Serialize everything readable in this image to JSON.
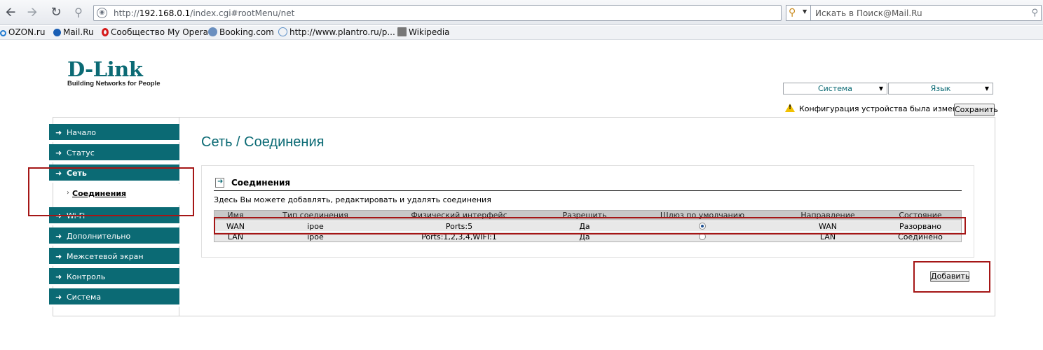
{
  "browser": {
    "url_prefix": "http://",
    "url_host": "192.168.0.1",
    "url_path": "/index.cgi#rootMenu/net",
    "search_placeholder": "Искать в Поиск@Mail.Ru"
  },
  "bookmarks": [
    {
      "label": "OZON.ru",
      "color": "#1f7ad1"
    },
    {
      "label": "Mail.Ru",
      "color": "#1a5fb4"
    },
    {
      "label": "Сообщество My Opera",
      "color": "#d61a1a"
    },
    {
      "label": "Booking.com",
      "color": "#6a8fbf"
    },
    {
      "label": "http://www.plantro.ru/p...",
      "color": "#5b8fc7"
    },
    {
      "label": "Wikipedia",
      "color": "#777777"
    }
  ],
  "header": {
    "logo_text": "D-Link",
    "logo_tagline": "Building Networks for People",
    "system_select": "Система",
    "language_select": "Язык",
    "warning_text": "Конфигурация устройства была изменена",
    "save_label": "Сохранить"
  },
  "sidebar": {
    "items": [
      {
        "label": "Начало"
      },
      {
        "label": "Статус"
      },
      {
        "label": "Сеть"
      },
      {
        "label": "Wi-Fi"
      },
      {
        "label": "Дополнительно"
      },
      {
        "label": "Межсетевой экран"
      },
      {
        "label": "Контроль"
      },
      {
        "label": "Система"
      }
    ],
    "sub_item": "Соединения"
  },
  "main": {
    "breadcrumb": "Сеть  /  Соединения",
    "panel_title": "Соединения",
    "panel_desc": "Здесь Вы можете добавлять, редактировать и удалять соединения",
    "columns": [
      "Имя",
      "Тип соединения",
      "Физический интерфейс",
      "Разрешить",
      "Шлюз по умолчанию",
      "Направление",
      "Состояние"
    ],
    "rows": [
      {
        "name": "WAN",
        "type": "ipoe",
        "iface": "Ports:5",
        "enabled": "Да",
        "gateway": true,
        "direction": "WAN",
        "state": "Разорвано"
      },
      {
        "name": "LAN",
        "type": "ipoe",
        "iface": "Ports:1,2,3,4,WIFI:1",
        "enabled": "Да",
        "gateway": false,
        "direction": "LAN",
        "state": "Соединено"
      }
    ],
    "add_label": "Добавить"
  },
  "colors": {
    "brand": "#0b6a74",
    "highlight_box": "#a51616",
    "warning": "#f2c100"
  }
}
